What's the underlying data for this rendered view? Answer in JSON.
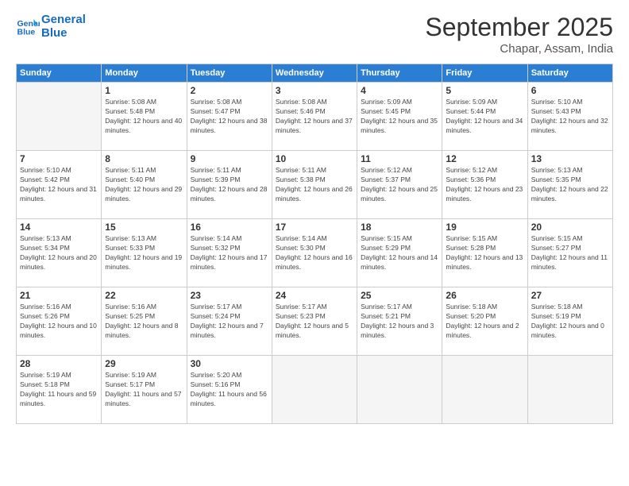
{
  "header": {
    "logo_line1": "General",
    "logo_line2": "Blue",
    "month_title": "September 2025",
    "subtitle": "Chapar, Assam, India"
  },
  "weekdays": [
    "Sunday",
    "Monday",
    "Tuesday",
    "Wednesday",
    "Thursday",
    "Friday",
    "Saturday"
  ],
  "weeks": [
    [
      {
        "day": "",
        "empty": true
      },
      {
        "day": "1",
        "sunrise": "5:08 AM",
        "sunset": "5:48 PM",
        "daylight": "12 hours and 40 minutes."
      },
      {
        "day": "2",
        "sunrise": "5:08 AM",
        "sunset": "5:47 PM",
        "daylight": "12 hours and 38 minutes."
      },
      {
        "day": "3",
        "sunrise": "5:08 AM",
        "sunset": "5:46 PM",
        "daylight": "12 hours and 37 minutes."
      },
      {
        "day": "4",
        "sunrise": "5:09 AM",
        "sunset": "5:45 PM",
        "daylight": "12 hours and 35 minutes."
      },
      {
        "day": "5",
        "sunrise": "5:09 AM",
        "sunset": "5:44 PM",
        "daylight": "12 hours and 34 minutes."
      },
      {
        "day": "6",
        "sunrise": "5:10 AM",
        "sunset": "5:43 PM",
        "daylight": "12 hours and 32 minutes."
      }
    ],
    [
      {
        "day": "7",
        "sunrise": "5:10 AM",
        "sunset": "5:42 PM",
        "daylight": "12 hours and 31 minutes."
      },
      {
        "day": "8",
        "sunrise": "5:11 AM",
        "sunset": "5:40 PM",
        "daylight": "12 hours and 29 minutes."
      },
      {
        "day": "9",
        "sunrise": "5:11 AM",
        "sunset": "5:39 PM",
        "daylight": "12 hours and 28 minutes."
      },
      {
        "day": "10",
        "sunrise": "5:11 AM",
        "sunset": "5:38 PM",
        "daylight": "12 hours and 26 minutes."
      },
      {
        "day": "11",
        "sunrise": "5:12 AM",
        "sunset": "5:37 PM",
        "daylight": "12 hours and 25 minutes."
      },
      {
        "day": "12",
        "sunrise": "5:12 AM",
        "sunset": "5:36 PM",
        "daylight": "12 hours and 23 minutes."
      },
      {
        "day": "13",
        "sunrise": "5:13 AM",
        "sunset": "5:35 PM",
        "daylight": "12 hours and 22 minutes."
      }
    ],
    [
      {
        "day": "14",
        "sunrise": "5:13 AM",
        "sunset": "5:34 PM",
        "daylight": "12 hours and 20 minutes."
      },
      {
        "day": "15",
        "sunrise": "5:13 AM",
        "sunset": "5:33 PM",
        "daylight": "12 hours and 19 minutes."
      },
      {
        "day": "16",
        "sunrise": "5:14 AM",
        "sunset": "5:32 PM",
        "daylight": "12 hours and 17 minutes."
      },
      {
        "day": "17",
        "sunrise": "5:14 AM",
        "sunset": "5:30 PM",
        "daylight": "12 hours and 16 minutes."
      },
      {
        "day": "18",
        "sunrise": "5:15 AM",
        "sunset": "5:29 PM",
        "daylight": "12 hours and 14 minutes."
      },
      {
        "day": "19",
        "sunrise": "5:15 AM",
        "sunset": "5:28 PM",
        "daylight": "12 hours and 13 minutes."
      },
      {
        "day": "20",
        "sunrise": "5:15 AM",
        "sunset": "5:27 PM",
        "daylight": "12 hours and 11 minutes."
      }
    ],
    [
      {
        "day": "21",
        "sunrise": "5:16 AM",
        "sunset": "5:26 PM",
        "daylight": "12 hours and 10 minutes."
      },
      {
        "day": "22",
        "sunrise": "5:16 AM",
        "sunset": "5:25 PM",
        "daylight": "12 hours and 8 minutes."
      },
      {
        "day": "23",
        "sunrise": "5:17 AM",
        "sunset": "5:24 PM",
        "daylight": "12 hours and 7 minutes."
      },
      {
        "day": "24",
        "sunrise": "5:17 AM",
        "sunset": "5:23 PM",
        "daylight": "12 hours and 5 minutes."
      },
      {
        "day": "25",
        "sunrise": "5:17 AM",
        "sunset": "5:21 PM",
        "daylight": "12 hours and 3 minutes."
      },
      {
        "day": "26",
        "sunrise": "5:18 AM",
        "sunset": "5:20 PM",
        "daylight": "12 hours and 2 minutes."
      },
      {
        "day": "27",
        "sunrise": "5:18 AM",
        "sunset": "5:19 PM",
        "daylight": "12 hours and 0 minutes."
      }
    ],
    [
      {
        "day": "28",
        "sunrise": "5:19 AM",
        "sunset": "5:18 PM",
        "daylight": "11 hours and 59 minutes."
      },
      {
        "day": "29",
        "sunrise": "5:19 AM",
        "sunset": "5:17 PM",
        "daylight": "11 hours and 57 minutes."
      },
      {
        "day": "30",
        "sunrise": "5:20 AM",
        "sunset": "5:16 PM",
        "daylight": "11 hours and 56 minutes."
      },
      {
        "day": "",
        "empty": true
      },
      {
        "day": "",
        "empty": true
      },
      {
        "day": "",
        "empty": true
      },
      {
        "day": "",
        "empty": true
      }
    ]
  ]
}
